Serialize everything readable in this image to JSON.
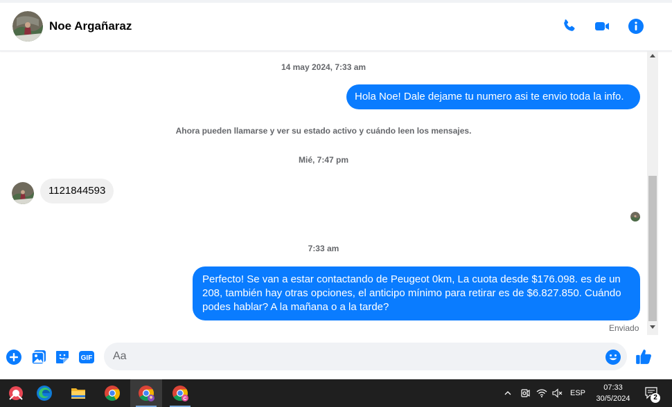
{
  "header": {
    "contact_name": "Noe Argañaraz",
    "icons": [
      "phone-icon",
      "video-call-icon",
      "info-icon"
    ],
    "accent_color": "#0a7cff"
  },
  "chat": {
    "timestamp_1": "14 may 2024, 7:33 am",
    "message_out_1": "Hola Noe! Dale dejame tu numero asi te envio toda la info.",
    "system_message": "Ahora pueden llamarse y ver su estado activo y cuándo leen los mensajes.",
    "timestamp_2": "Mié, 7:47 pm",
    "message_in_1": "1121844593",
    "timestamp_3": "7:33 am",
    "message_out_2": "Perfecto!  Se van a estar contactando de Peugeot 0km, La cuota desde $176.098. es de un 208, también hay otras opciones, el anticipo mínimo para retirar es de $6.827.850. Cuándo podes hablar? A la mañana o a la tarde?",
    "delivery_status": "Enviado"
  },
  "composer": {
    "placeholder": "Aa",
    "gif_label": "GIF",
    "icons": [
      "plus-icon",
      "photo-icon",
      "sticker-icon",
      "gif-icon",
      "emoji-icon",
      "thumbs-up-icon"
    ]
  },
  "taskbar": {
    "apps": [
      "snipping-tool-icon",
      "edge-icon",
      "file-explorer-icon",
      "chrome-icon",
      "chrome-profile-icon",
      "chrome-profile-c-icon"
    ],
    "language": "ESP",
    "time": "07:33",
    "date": "30/5/2024",
    "notification_count": "2"
  }
}
